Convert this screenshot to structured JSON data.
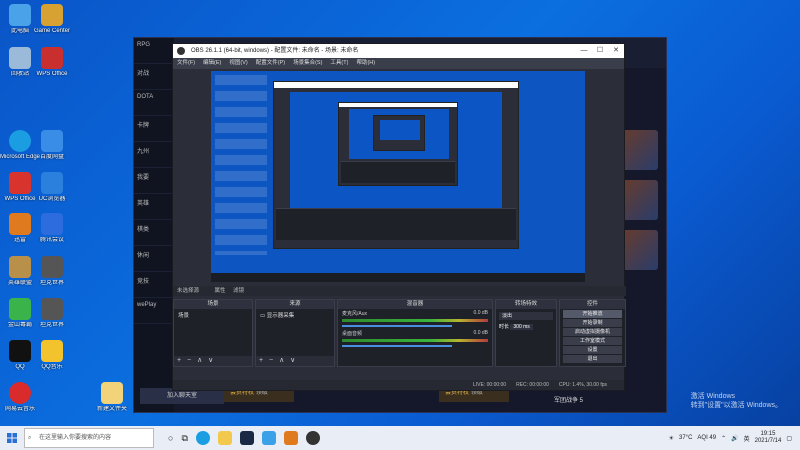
{
  "desktop": {
    "icons_left": [
      {
        "label": "此电脑",
        "color": "#4aa3e8"
      },
      {
        "label": "回收站",
        "color": "#9bbad9"
      },
      {
        "label": "Microsoft Edge",
        "color": "#1b9de2"
      },
      {
        "label": "WPS Office",
        "color": "#d9332e"
      },
      {
        "label": "迅雷",
        "color": "#2d8be0"
      },
      {
        "label": "网易云音乐",
        "color": "#d92b2b"
      },
      {
        "label": "QQ",
        "color": "#111111"
      },
      {
        "label": "英雄联盟",
        "color": "#b8904a"
      },
      {
        "label": "金山毒霸",
        "color": "#e07a1f"
      }
    ],
    "icons_col2": [
      {
        "label": "Game Center",
        "color": "#d8a233"
      },
      {
        "label": "WPS Office",
        "color": "#c92f2f"
      },
      {
        "label": "百度网盘",
        "color": "#3a8de6"
      },
      {
        "label": "UC浏览器",
        "color": "#2b7fdd"
      },
      {
        "label": "腾讯会议",
        "color": "#2d6cdf"
      },
      {
        "label": "坦克世界",
        "color": "#555555"
      },
      {
        "label": "坦克世界",
        "color": "#555555"
      },
      {
        "label": "QQ音乐",
        "color": "#f2c32c"
      },
      {
        "label": "新建文件夹",
        "color": "#f2d37a"
      }
    ]
  },
  "launcher": {
    "sidebar_items": [
      "RPG",
      "对战",
      "DOTA",
      "卡牌",
      "九州",
      "我要",
      "英雄",
      "棋类",
      "休闲",
      "竞技",
      "wePlay"
    ],
    "footer_button": "加入聊天室",
    "promo_label": "会员特权",
    "promo_sub": "领取",
    "card_title": "军团战争 5"
  },
  "obs": {
    "title": "OBS 26.1.1 (64-bit, windows) - 配置文件: 未命名 - 场景: 未命名",
    "window_controls": [
      "—",
      "☐",
      "✕"
    ],
    "menu": [
      "文件(F)",
      "编辑(E)",
      "视图(V)",
      "配置文件(P)",
      "场景集合(S)",
      "工具(T)",
      "帮助(H)"
    ],
    "dock_strip": [
      "未选择源",
      "属性",
      "滤镜"
    ],
    "scenes": {
      "title": "场景",
      "items": [
        "场景"
      ]
    },
    "sources": {
      "title": "来源",
      "items": [
        "显示器采集"
      ]
    },
    "mixer": {
      "title": "混音器",
      "channels": [
        {
          "name": "麦克风/Aux",
          "db": "0.0 dB"
        },
        {
          "name": "桌面音频",
          "db": "0.0 dB"
        }
      ]
    },
    "transitions": {
      "title": "转场特效",
      "type": "淡出",
      "duration_label": "时长",
      "duration": "300 ms"
    },
    "controls": {
      "title": "控件",
      "buttons": [
        "开始推流",
        "开始录制",
        "启动虚拟摄像机",
        "工作室模式",
        "设置",
        "退出"
      ]
    },
    "status": [
      "LIVE: 00:00:00",
      "REC: 00:00:00",
      "CPU: 1.4%, 30.00 fps"
    ],
    "dock_footer": "+ − ∧ ∨"
  },
  "watermark": {
    "line1": "激活 Windows",
    "line2": "转到\"设置\"以激活 Windows。"
  },
  "taskbar": {
    "search_placeholder": "在这里输入你要搜索的内容",
    "weather": "37°C",
    "aqi": "AQI 49",
    "ime": "英",
    "time": "19:15",
    "date": "2021/7/14"
  }
}
